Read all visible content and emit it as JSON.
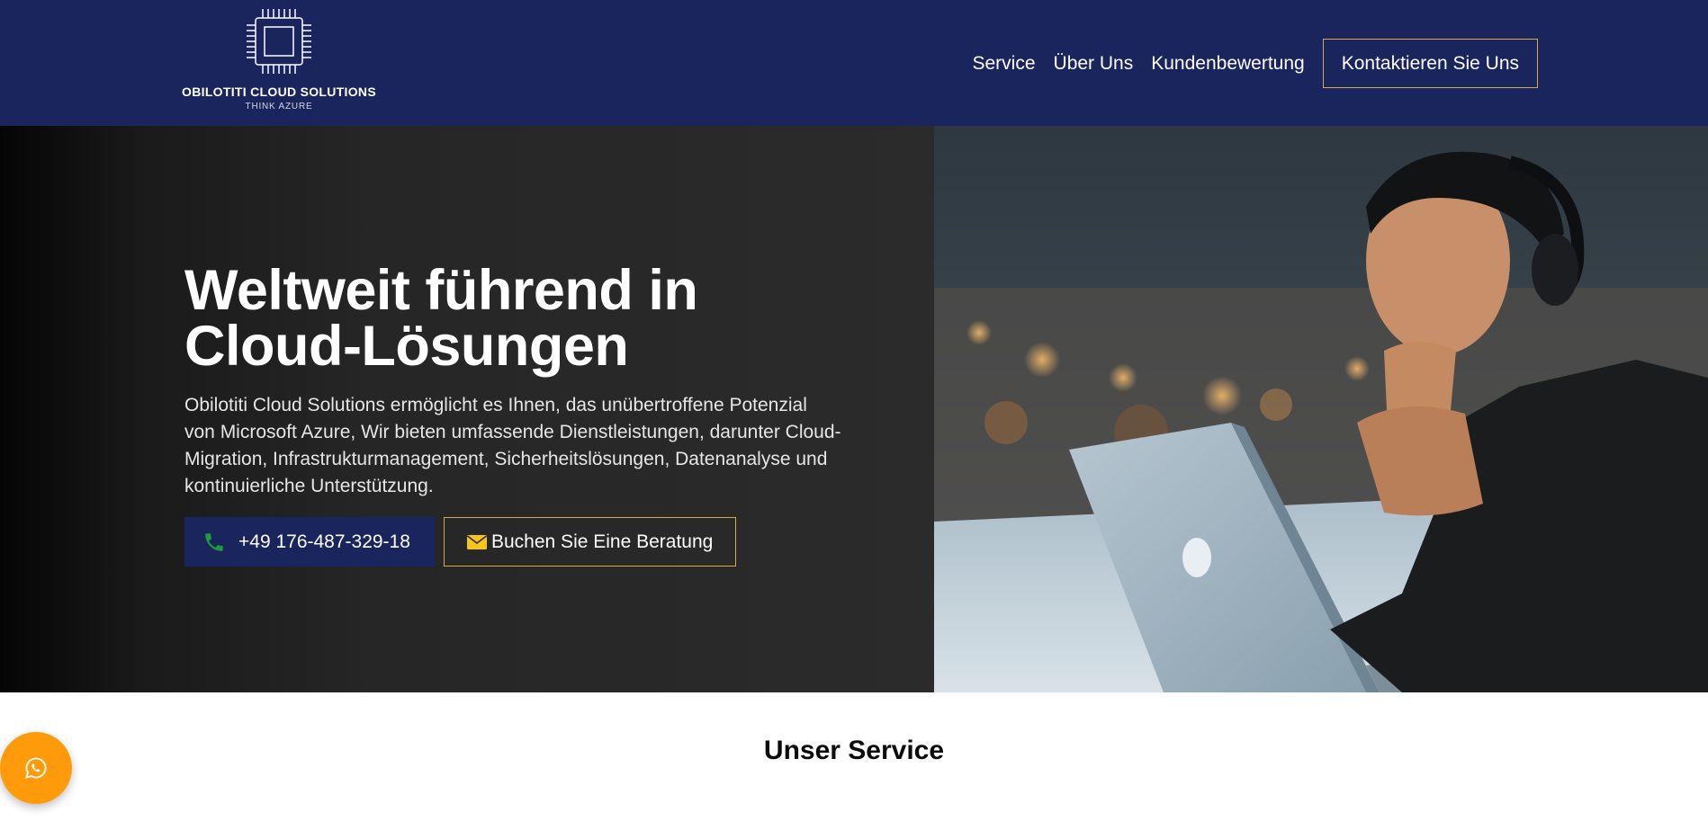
{
  "header": {
    "logo": {
      "name": "OBILOTITI CLOUD SOLUTIONS",
      "tagline": "THINK AZURE",
      "icon": "chip-icon"
    },
    "nav": {
      "items": [
        {
          "label": "Service"
        },
        {
          "label": "Über Uns"
        },
        {
          "label": "Kundenbewertung"
        }
      ],
      "cta_label": "Kontaktieren Sie Uns"
    }
  },
  "hero": {
    "title_line1": "Weltweit führend in",
    "title_line2": "Cloud-Lösungen",
    "description": "Obilotiti Cloud Solutions ermöglicht es Ihnen, das unübertroffene Potenzial von Microsoft Azure, Wir bieten umfassende Dienstleistungen, darunter Cloud-Migration, Infrastrukturmanagement, Sicherheitslösungen, Datenanalyse und kontinuierliche Unterstützung.",
    "phone_label": "+49 176-487-329-18",
    "phone_icon": "phone-icon",
    "book_label": "Buchen Sie Eine Beratung",
    "book_icon": "envelope-icon",
    "image": "man-with-headphones-and-laptop-photo"
  },
  "services": {
    "title": "Unser Service"
  },
  "whatsapp": {
    "icon": "whatsapp-icon"
  },
  "colors": {
    "navy": "#19255c",
    "gold_border": "#d4aa4a",
    "hero_dark": "#2b2b2b",
    "whatsapp_orange": "#ff9b0a",
    "phone_green": "#1e9b3c",
    "envelope_yellow": "#f5c518"
  }
}
